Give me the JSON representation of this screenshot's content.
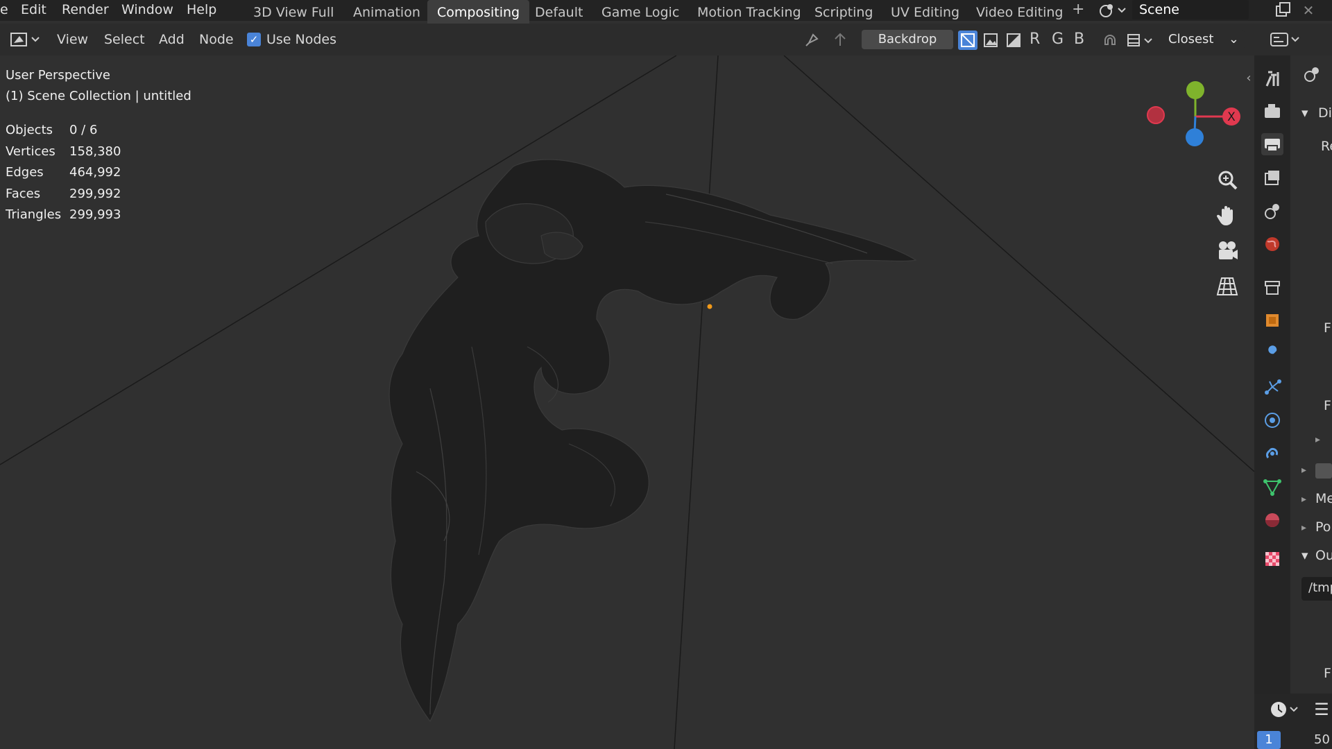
{
  "menu": {
    "items": [
      "e",
      "Edit",
      "Render",
      "Window",
      "Help"
    ]
  },
  "workspaces": {
    "tabs": [
      "3D View Full",
      "Animation",
      "Compositing",
      "Default",
      "Game Logic",
      "Motion Tracking",
      "Scripting",
      "UV Editing",
      "Video Editing"
    ],
    "active": "Compositing",
    "add_label": "+"
  },
  "scene": {
    "name": "Scene"
  },
  "header": {
    "view": "View",
    "select": "Select",
    "add": "Add",
    "node": "Node",
    "use_nodes_label": "Use Nodes",
    "use_nodes_checked": true,
    "backdrop": "Backdrop",
    "channel_r": "R",
    "channel_g": "G",
    "channel_b": "B",
    "filter": "Closest"
  },
  "viewport": {
    "perspective": "User Perspective",
    "collection": "(1) Scene Collection | untitled",
    "stats": [
      {
        "label": "Objects",
        "value": "0 / 6"
      },
      {
        "label": "Vertices",
        "value": "158,380"
      },
      {
        "label": "Edges",
        "value": "464,992"
      },
      {
        "label": "Faces",
        "value": "299,992"
      },
      {
        "label": "Triangles",
        "value": "299,993"
      }
    ],
    "gizmo_x_label": "X"
  },
  "properties": {
    "partial_labels": [
      "Di",
      "Re",
      "F",
      "F",
      "Me",
      "Po",
      "Ou",
      "/tmp",
      "F"
    ]
  },
  "timeline": {
    "frame": "1",
    "end_frame": "50"
  },
  "colors": {
    "accent_blue": "#4a84d8",
    "axis_x": "#e0394f",
    "axis_y": "#7fb32c",
    "axis_z": "#2f80d8",
    "origin": "#f29a19"
  }
}
